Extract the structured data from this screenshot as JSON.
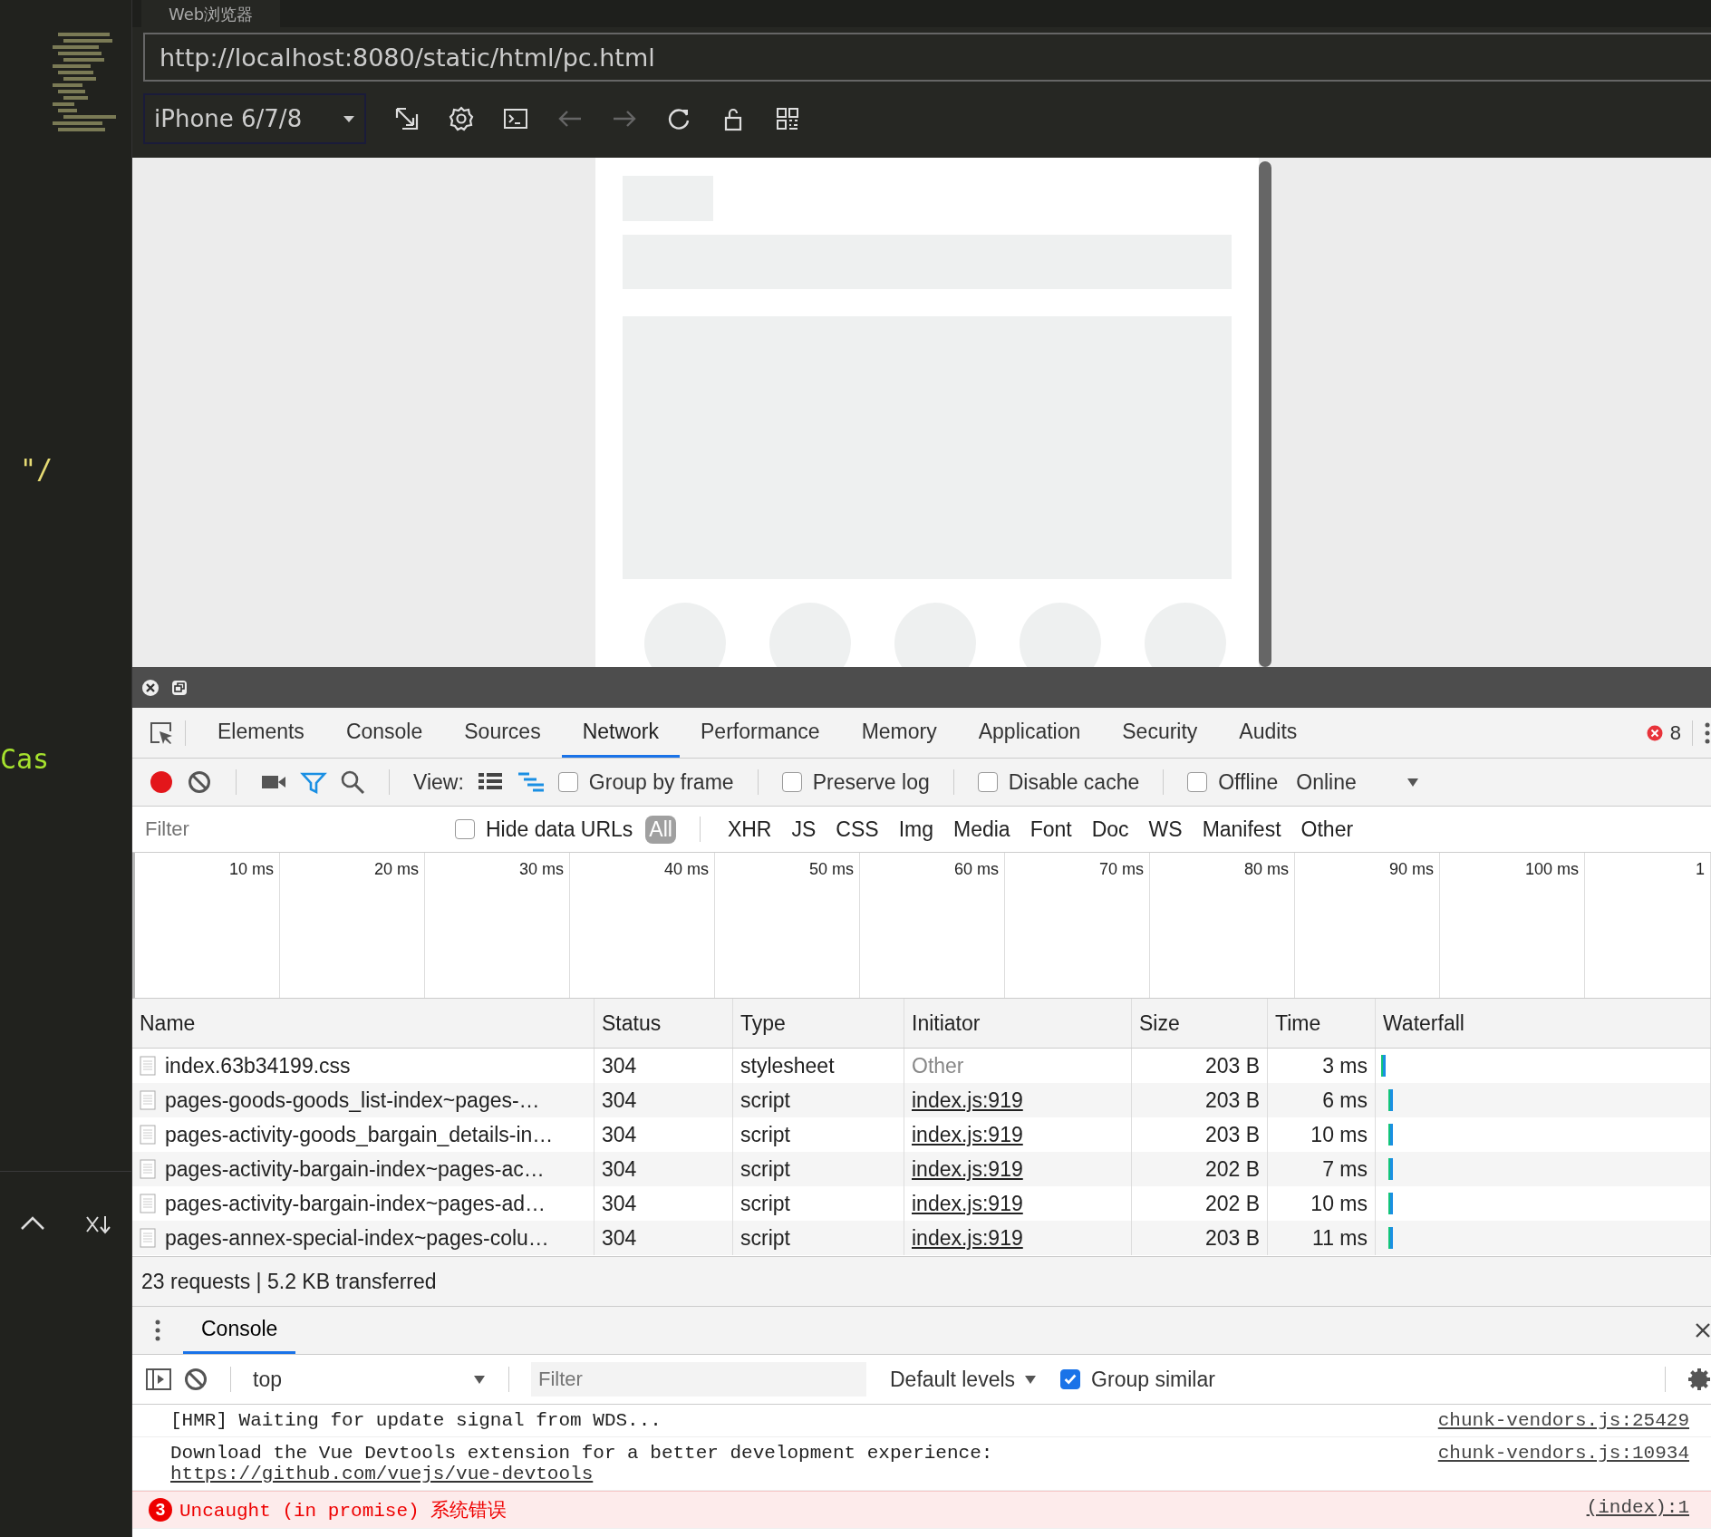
{
  "editor": {
    "code_fragments": [
      "\"/",
      "Cas"
    ]
  },
  "browser": {
    "tab_title": "Web浏览器",
    "address": "http://localhost:8080/static/html/pc.html",
    "device": "iPhone 6/7/8"
  },
  "devtools": {
    "tabs": [
      {
        "label": "Elements",
        "selected": false
      },
      {
        "label": "Console",
        "selected": false
      },
      {
        "label": "Sources",
        "selected": false
      },
      {
        "label": "Network",
        "selected": true
      },
      {
        "label": "Performance",
        "selected": false
      },
      {
        "label": "Memory",
        "selected": false
      },
      {
        "label": "Application",
        "selected": false
      },
      {
        "label": "Security",
        "selected": false
      },
      {
        "label": "Audits",
        "selected": false
      }
    ],
    "error_count": "8"
  },
  "network": {
    "recording": true,
    "view_label": "View:",
    "options": [
      {
        "label": "Group by frame",
        "checked": false
      },
      {
        "label": "Preserve log",
        "checked": false
      },
      {
        "label": "Disable cache",
        "checked": false
      },
      {
        "label": "Offline",
        "checked": false
      }
    ],
    "throttling": "Online",
    "filter": {
      "placeholder": "Filter"
    },
    "hide_data_urls": {
      "label": "Hide data URLs",
      "checked": false
    },
    "type_filters": [
      {
        "label": "All",
        "selected": true
      },
      {
        "label": "XHR",
        "selected": false
      },
      {
        "label": "JS",
        "selected": false
      },
      {
        "label": "CSS",
        "selected": false
      },
      {
        "label": "Img",
        "selected": false
      },
      {
        "label": "Media",
        "selected": false
      },
      {
        "label": "Font",
        "selected": false
      },
      {
        "label": "Doc",
        "selected": false
      },
      {
        "label": "WS",
        "selected": false
      },
      {
        "label": "Manifest",
        "selected": false
      },
      {
        "label": "Other",
        "selected": false
      }
    ],
    "timeline_ticks": [
      "10 ms",
      "20 ms",
      "30 ms",
      "40 ms",
      "50 ms",
      "60 ms",
      "70 ms",
      "80 ms",
      "90 ms",
      "100 ms",
      "1"
    ],
    "table": {
      "columns": [
        "Name",
        "Status",
        "Type",
        "Initiator",
        "Size",
        "Time",
        "Waterfall"
      ],
      "rows": [
        {
          "name": "index.63b34199.css",
          "status": "304",
          "type": "stylesheet",
          "initiator": "Other",
          "kind": "other",
          "size": "203 B",
          "time": "3 ms"
        },
        {
          "name": "pages-goods-goods_list-index~pages-…",
          "status": "304",
          "type": "script",
          "initiator": "index.js:919",
          "kind": "link",
          "size": "203 B",
          "time": "6 ms"
        },
        {
          "name": "pages-activity-goods_bargain_details-in…",
          "status": "304",
          "type": "script",
          "initiator": "index.js:919",
          "kind": "link",
          "size": "203 B",
          "time": "10 ms"
        },
        {
          "name": "pages-activity-bargain-index~pages-ac…",
          "status": "304",
          "type": "script",
          "initiator": "index.js:919",
          "kind": "link",
          "size": "202 B",
          "time": "7 ms"
        },
        {
          "name": "pages-activity-bargain-index~pages-ad…",
          "status": "304",
          "type": "script",
          "initiator": "index.js:919",
          "kind": "link",
          "size": "202 B",
          "time": "10 ms"
        },
        {
          "name": "pages-annex-special-index~pages-colu…",
          "status": "304",
          "type": "script",
          "initiator": "index.js:919",
          "kind": "link",
          "size": "203 B",
          "time": "11 ms"
        }
      ]
    },
    "summary": "23 requests | 5.2 KB transferred"
  },
  "console": {
    "tab": "Console",
    "context": "top",
    "filter": {
      "placeholder": "Filter"
    },
    "levels": "Default levels",
    "group_similar": {
      "label": "Group similar",
      "checked": true
    },
    "messages": [
      {
        "kind": "log",
        "text": "[HMR] Waiting for update signal from WDS...",
        "source": "chunk-vendors.js:25429"
      },
      {
        "kind": "log",
        "text": "Download the Vue Devtools extension for a better development experience:",
        "link": "https://github.com/vuejs/vue-devtools",
        "source": "chunk-vendors.js:10934"
      },
      {
        "kind": "error",
        "count": "3",
        "text": "Uncaught (in promise) 系统错误",
        "source": "(index):1"
      }
    ]
  }
}
